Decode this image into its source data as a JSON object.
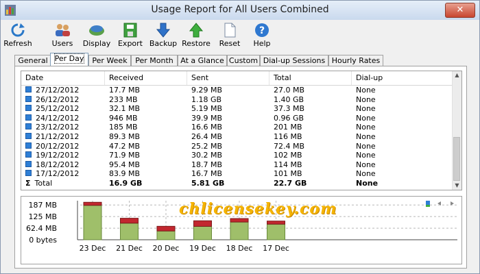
{
  "window": {
    "title": "Usage Report for All Users Combined",
    "close_glyph": "✕"
  },
  "toolbar": [
    {
      "label": "Refresh",
      "icon": "refresh-icon"
    },
    {
      "label": "Users",
      "icon": "users-icon"
    },
    {
      "label": "Display",
      "icon": "display-icon"
    },
    {
      "label": "Export",
      "icon": "export-icon"
    },
    {
      "label": "Backup",
      "icon": "backup-icon"
    },
    {
      "label": "Restore",
      "icon": "restore-icon"
    },
    {
      "label": "Reset",
      "icon": "reset-icon"
    },
    {
      "label": "Help",
      "icon": "help-icon"
    }
  ],
  "tabs": [
    "General",
    "Per Day",
    "Per Week",
    "Per Month",
    "At a Glance",
    "Custom",
    "Dial-up Sessions",
    "Hourly Rates"
  ],
  "active_tab": "Per Day",
  "table": {
    "columns": [
      "Date",
      "Received",
      "Sent",
      "Total",
      "Dial-up"
    ],
    "rows": [
      [
        "27/12/2012",
        "17.7 MB",
        "9.29 MB",
        "27.0 MB",
        "None"
      ],
      [
        "26/12/2012",
        "233 MB",
        "1.18 GB",
        "1.40 GB",
        "None"
      ],
      [
        "25/12/2012",
        "32.1 MB",
        "5.19 MB",
        "37.3 MB",
        "None"
      ],
      [
        "24/12/2012",
        "946 MB",
        "39.9 MB",
        "0.96 GB",
        "None"
      ],
      [
        "23/12/2012",
        "185 MB",
        "16.6 MB",
        "201 MB",
        "None"
      ],
      [
        "21/12/2012",
        "89.3 MB",
        "26.4 MB",
        "116 MB",
        "None"
      ],
      [
        "20/12/2012",
        "47.2 MB",
        "25.2 MB",
        "72.4 MB",
        "None"
      ],
      [
        "19/12/2012",
        "71.9 MB",
        "30.2 MB",
        "102 MB",
        "None"
      ],
      [
        "18/12/2012",
        "95.4 MB",
        "18.7 MB",
        "114 MB",
        "None"
      ],
      [
        "17/12/2012",
        "83.9 MB",
        "16.7 MB",
        "101 MB",
        "None"
      ]
    ],
    "total": {
      "sigma": "Σ",
      "label": "Total",
      "received": "16.9 GB",
      "sent": "5.81 GB",
      "total": "22.7 GB",
      "dialup": "None"
    }
  },
  "chart_data": {
    "type": "bar",
    "categories": [
      "23 Dec",
      "21 Dec",
      "20 Dec",
      "19 Dec",
      "18 Dec",
      "17 Dec"
    ],
    "series": [
      {
        "values": [
          185,
          89.3,
          47.2,
          71.9,
          95.4,
          83.9
        ],
        "color": "#9fbf6a"
      },
      {
        "values": [
          16.6,
          26.4,
          25.2,
          30.2,
          18.7,
          16.7
        ],
        "color": "#c2272f"
      }
    ],
    "yticks": [
      "187 MB",
      "125 MB",
      "62.4 MB",
      "0 bytes"
    ],
    "ylim": [
      0,
      210
    ],
    "grid": true
  },
  "watermark": "chlicensekey.com",
  "colors": {
    "accent": "#2f7fd6",
    "received": "#9fbf6a",
    "sent": "#c2272f"
  }
}
